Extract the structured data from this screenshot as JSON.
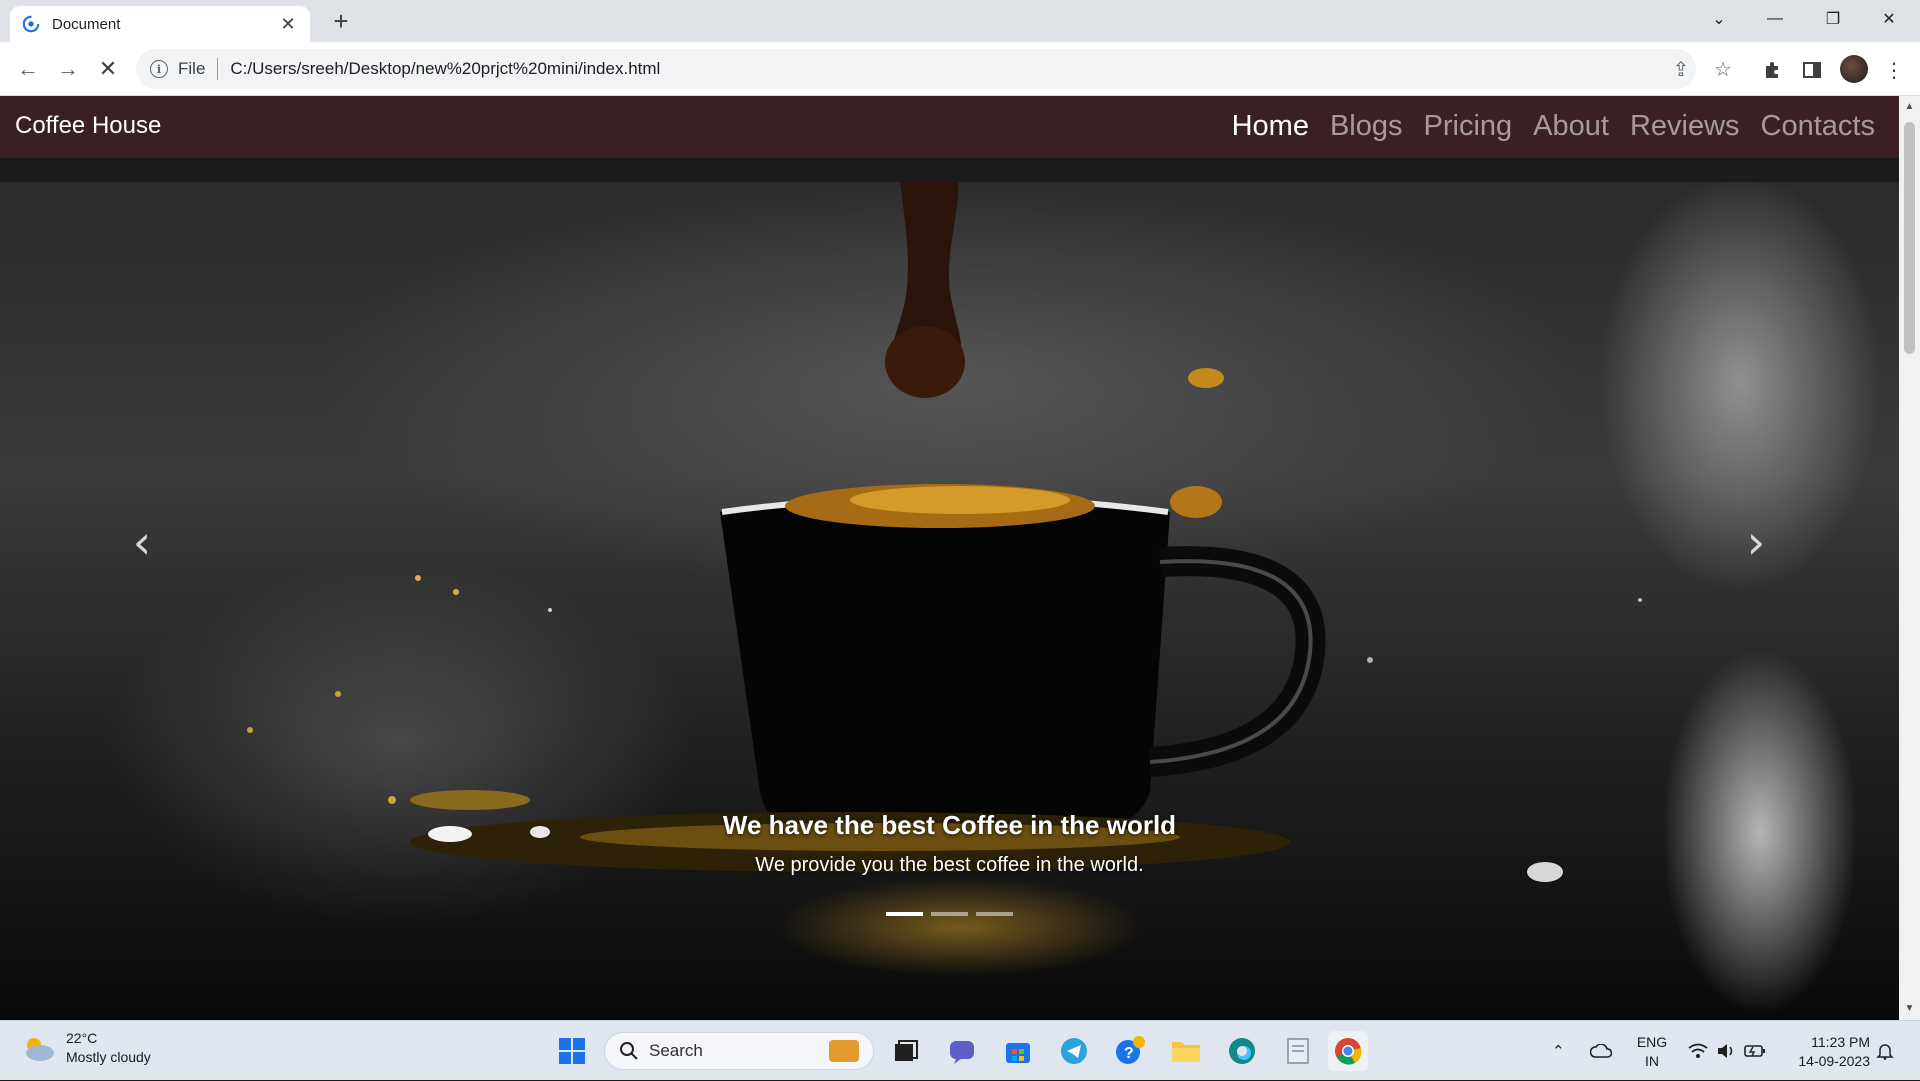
{
  "browser": {
    "tab_title": "Document",
    "scheme_label": "File",
    "url": "C:/Users/sreeh/Desktop/new%20prjct%20mini/index.html"
  },
  "site": {
    "brand": "Coffee House",
    "nav": [
      {
        "label": "Home",
        "active": true
      },
      {
        "label": "Blogs",
        "active": false
      },
      {
        "label": "Pricing",
        "active": false
      },
      {
        "label": "About",
        "active": false
      },
      {
        "label": "Reviews",
        "active": false
      },
      {
        "label": "Contacts",
        "active": false
      }
    ],
    "carousel": {
      "caption_title": "We have the best Coffee in the world",
      "caption_text": "We provide you the best coffee in the world.",
      "slides": 3,
      "active_slide": 1
    }
  },
  "taskbar": {
    "weather_temp": "22°C",
    "weather_desc": "Mostly cloudy",
    "search_label": "Search",
    "lang_top": "ENG",
    "lang_bottom": "IN",
    "time": "11:23 PM",
    "date": "14-09-2023"
  }
}
